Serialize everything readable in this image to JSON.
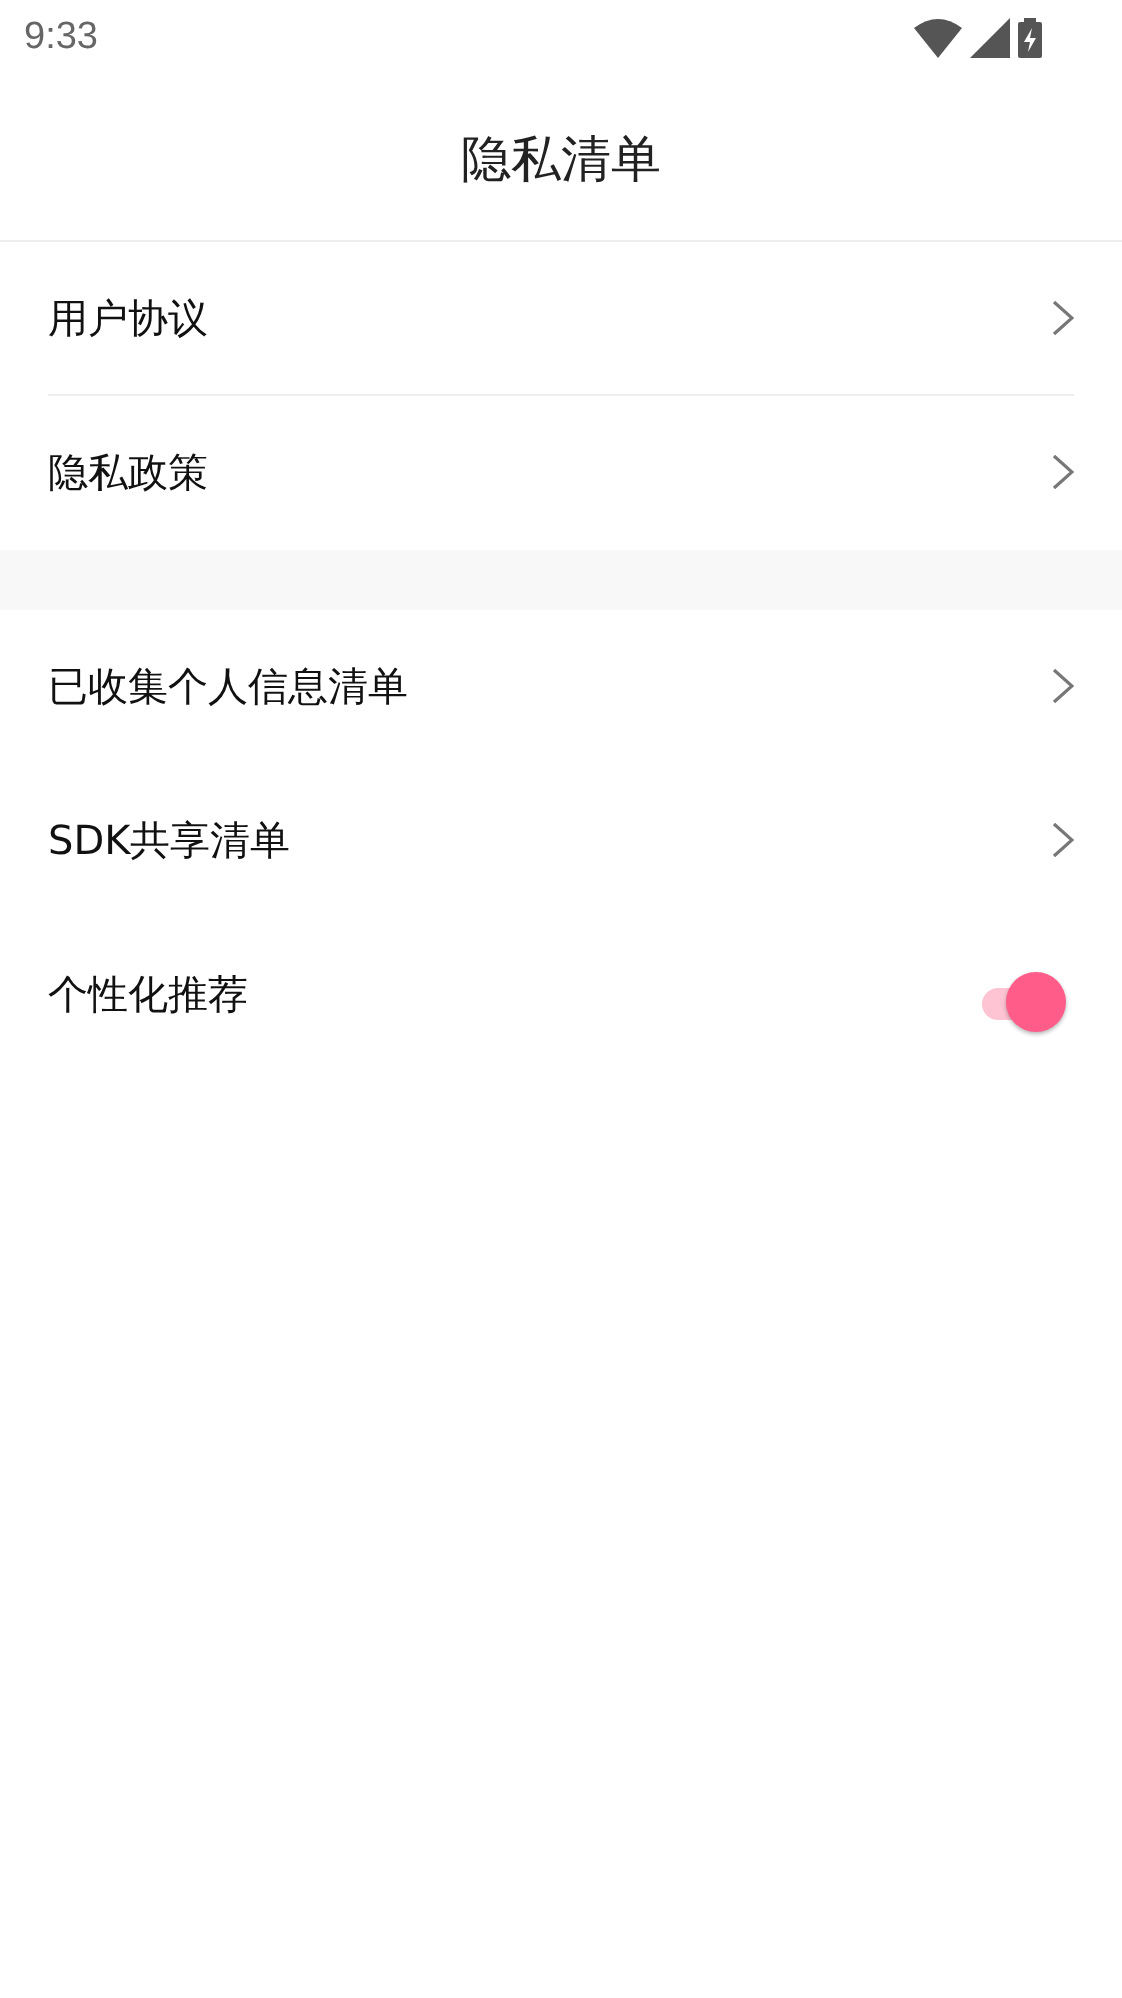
{
  "status_bar": {
    "time": "9:33"
  },
  "header": {
    "title": "隐私清单"
  },
  "groups": [
    {
      "divided": true,
      "items": [
        {
          "kind": "link",
          "label": "用户协议"
        },
        {
          "kind": "link",
          "label": "隐私政策"
        }
      ]
    },
    {
      "divided": false,
      "items": [
        {
          "kind": "link",
          "label": "已收集个人信息清单"
        },
        {
          "kind": "link",
          "label": "SDK共享清单"
        },
        {
          "kind": "switch",
          "label": "个性化推荐",
          "on": true
        }
      ]
    }
  ]
}
